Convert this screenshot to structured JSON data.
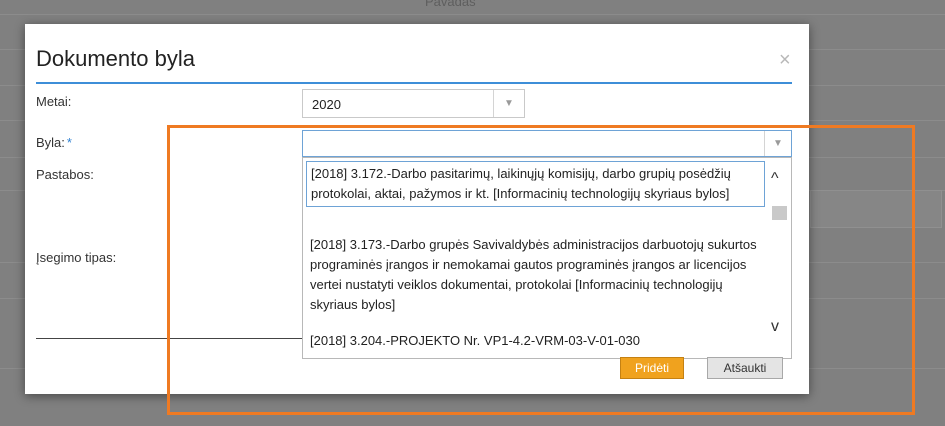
{
  "background": {
    "top_text": "Pavadas"
  },
  "modal": {
    "title": "Dokumento byla",
    "close_glyph": "×",
    "fields": {
      "metai_label": "Metai:",
      "byla_label": "Byla:",
      "byla_required_mark": "*",
      "pastabos_label": "Pastabos:",
      "isegimo_label": "Įsegimo tipas:"
    },
    "metai_select": {
      "value": "2020",
      "arrow_icon": "▼"
    },
    "byla_select": {
      "value": "",
      "arrow_icon": "▼"
    },
    "dropdown_options": [
      "[2018] 3.172.-Darbo pasitarimų, laikinųjų komisijų, darbo grupių posėdžių protokolai, aktai, pažymos ir kt. [Informacinių technologijų skyriaus bylos]",
      "[2018] 3.173.-Darbo grupės Savivaldybės administracijos darbuotojų sukurtos programinės įrangos ir nemokamai gautos programinės įrangos ar licencijos vertei nustatyti veiklos dokumentai, protokolai [Informacinių technologijų skyriaus bylos]",
      "[2018] 3.204.-PROJEKTO Nr. VP1-4.2-VRM-03-V-01-030"
    ],
    "scroll_up_icon": "^",
    "scroll_down_icon": "v",
    "buttons": {
      "add_label": "Pridėti",
      "cancel_label": "Atšaukti"
    }
  },
  "colors": {
    "accent": "#3d8ed8",
    "add_button": "#f0a21e",
    "annotation": "#ef7a22"
  }
}
